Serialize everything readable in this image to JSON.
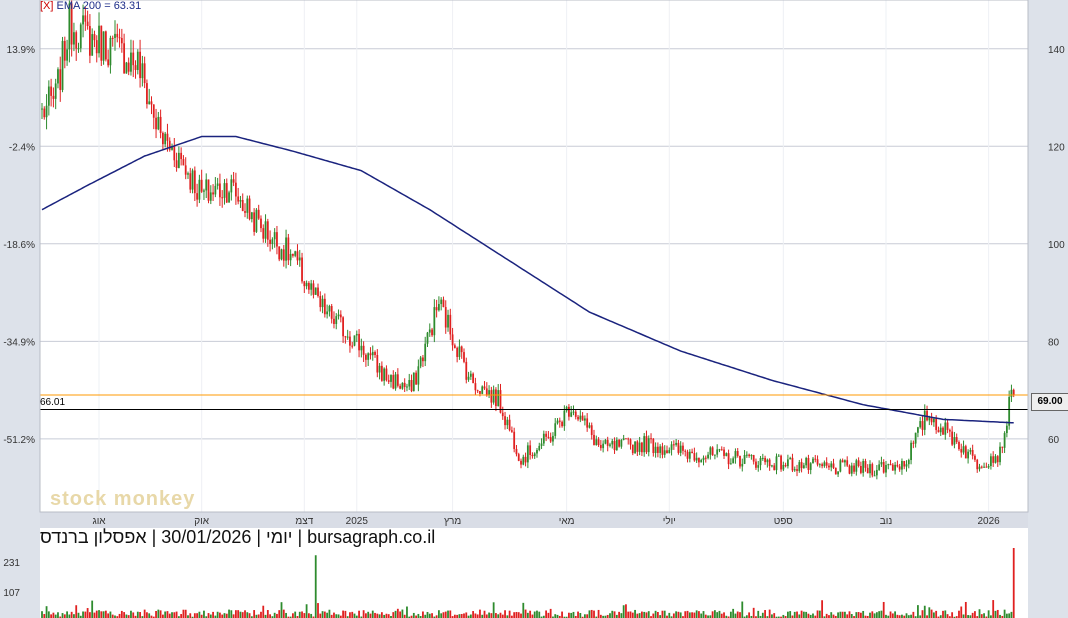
{
  "chart_data": {
    "type": "candlestick",
    "legend": {
      "close_marker": "[X]",
      "indicator_label": "EMA 200 = 63.31"
    },
    "caption": "יומי | 30/01/2026 | אפסלון ברנדס | bursagraph.co.il",
    "watermark": "stock monkey",
    "last_price_label": "69.00",
    "reference_line": {
      "value": 66.01,
      "label": "66.01",
      "color": "#000000"
    },
    "resistance_line": {
      "value": 69.0,
      "color": "#ff9900"
    },
    "y_right": {
      "ticks": [
        60,
        80,
        100,
        120,
        140
      ],
      "ylim": [
        45,
        150
      ]
    },
    "y_left": {
      "labels": [
        "13.9%",
        "-2.4%",
        "-18.6%",
        "-34.9%",
        "-51.2%"
      ],
      "at_price": [
        140,
        120,
        100,
        80,
        60
      ]
    },
    "x_axis": {
      "labels": [
        "אוג",
        "אוק",
        "דצמ",
        "2025",
        "מרץ",
        "מאי",
        "יולי",
        "ספט",
        "נוב",
        "2026"
      ],
      "label_index": [
        25,
        70,
        115,
        138,
        180,
        230,
        275,
        325,
        370,
        415
      ]
    },
    "volume_axis": {
      "ticks": [
        107,
        231
      ],
      "vmax": 290
    },
    "series_keypoints": [
      {
        "index": 0,
        "price": 127
      },
      {
        "index": 6,
        "price": 130
      },
      {
        "index": 12,
        "price": 145
      },
      {
        "index": 22,
        "price": 142
      },
      {
        "index": 32,
        "price": 140
      },
      {
        "index": 42,
        "price": 137
      },
      {
        "index": 52,
        "price": 122
      },
      {
        "index": 60,
        "price": 118
      },
      {
        "index": 70,
        "price": 110
      },
      {
        "index": 82,
        "price": 112
      },
      {
        "index": 95,
        "price": 104
      },
      {
        "index": 110,
        "price": 97
      },
      {
        "index": 122,
        "price": 87
      },
      {
        "index": 138,
        "price": 80
      },
      {
        "index": 150,
        "price": 73
      },
      {
        "index": 162,
        "price": 70
      },
      {
        "index": 174,
        "price": 88
      },
      {
        "index": 188,
        "price": 72
      },
      {
        "index": 200,
        "price": 68
      },
      {
        "index": 210,
        "price": 56
      },
      {
        "index": 222,
        "price": 60
      },
      {
        "index": 232,
        "price": 67
      },
      {
        "index": 245,
        "price": 58
      },
      {
        "index": 265,
        "price": 59
      },
      {
        "index": 285,
        "price": 57
      },
      {
        "index": 305,
        "price": 56
      },
      {
        "index": 325,
        "price": 55
      },
      {
        "index": 345,
        "price": 54
      },
      {
        "index": 365,
        "price": 54
      },
      {
        "index": 378,
        "price": 55
      },
      {
        "index": 388,
        "price": 65
      },
      {
        "index": 400,
        "price": 60
      },
      {
        "index": 410,
        "price": 55
      },
      {
        "index": 420,
        "price": 57
      },
      {
        "index": 425,
        "price": 69
      }
    ],
    "ema200_keypoints": [
      {
        "index": 0,
        "value": 107
      },
      {
        "index": 20,
        "value": 112
      },
      {
        "index": 45,
        "value": 118
      },
      {
        "index": 70,
        "value": 122
      },
      {
        "index": 85,
        "value": 122
      },
      {
        "index": 110,
        "value": 119
      },
      {
        "index": 140,
        "value": 115
      },
      {
        "index": 170,
        "value": 107
      },
      {
        "index": 200,
        "value": 98
      },
      {
        "index": 240,
        "value": 86
      },
      {
        "index": 280,
        "value": 78
      },
      {
        "index": 320,
        "value": 72
      },
      {
        "index": 360,
        "value": 67
      },
      {
        "index": 395,
        "value": 64
      },
      {
        "index": 425,
        "value": 63.31
      }
    ],
    "colors": {
      "up": "#2e8b2e",
      "down": "#e02020",
      "ema": "#1a237e",
      "grid": "#c8ccd6",
      "plot_bg": "#ffffff"
    }
  }
}
